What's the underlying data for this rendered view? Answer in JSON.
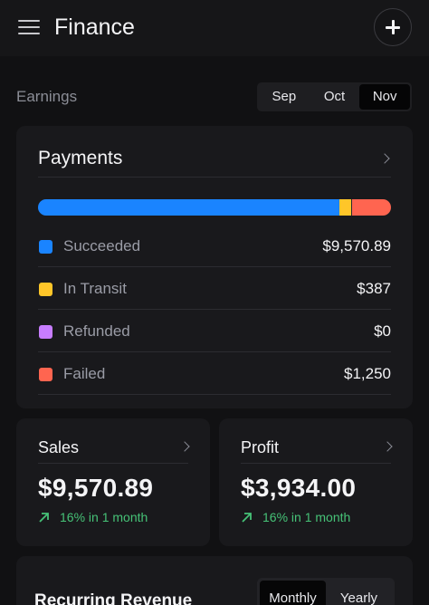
{
  "header": {
    "title": "Finance",
    "menu_icon": "hamburger-menu-icon",
    "add_icon": "plus-icon"
  },
  "earnings": {
    "label": "Earnings",
    "months": [
      {
        "label": "Sep",
        "active": false
      },
      {
        "label": "Oct",
        "active": false
      },
      {
        "label": "Nov",
        "active": true
      }
    ]
  },
  "payments": {
    "title": "Payments",
    "items": [
      {
        "label": "Succeeded",
        "value": "$9,570.89",
        "amount": 9570.89,
        "color": "#1a84ff"
      },
      {
        "label": "In Transit",
        "value": "$387",
        "amount": 387,
        "color": "#ffc629"
      },
      {
        "label": "Refunded",
        "value": "$0",
        "amount": 0,
        "color": "#c77dff"
      },
      {
        "label": "Failed",
        "value": "$1,250",
        "amount": 1250,
        "color": "#ff6550"
      }
    ]
  },
  "sales": {
    "title": "Sales",
    "value": "$9,570.89",
    "trend": "16% in 1 month"
  },
  "profit": {
    "title": "Profit",
    "value": "$3,934.00",
    "trend": "16% in 1 month"
  },
  "recurring": {
    "title": "Recurring Revenue",
    "periods": [
      {
        "label": "Monthly",
        "active": true
      },
      {
        "label": "Yearly",
        "active": false
      }
    ]
  },
  "colors": {
    "trend_up": "#46c277",
    "background": "#111113",
    "card": "#19191c"
  }
}
